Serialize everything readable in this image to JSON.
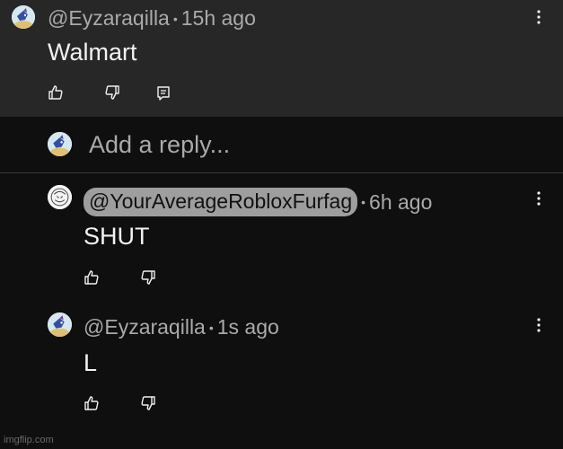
{
  "top_comment": {
    "author": "@Eyzaraqilla",
    "separator": "•",
    "time": "15h ago",
    "text": "Walmart"
  },
  "reply_box": {
    "placeholder": "Add a reply..."
  },
  "replies": [
    {
      "author": "@YourAverageRobloxFurfag",
      "separator": "•",
      "time": "6h ago",
      "text": "SHUT"
    },
    {
      "author": "@Eyzaraqilla",
      "separator": "•",
      "time": "1s ago",
      "text": "L"
    }
  ],
  "watermark": "imgflip.com",
  "icons": {
    "like": "thumbs-up-icon",
    "dislike": "thumbs-down-icon",
    "reply": "reply-icon",
    "more": "more-vert-icon"
  },
  "colors": {
    "background": "#0f0f0f",
    "highlight": "#272727",
    "mention_chip": "#9e9e9e",
    "secondary_text": "#aaaaaa",
    "primary_text": "#f1f1f1"
  }
}
